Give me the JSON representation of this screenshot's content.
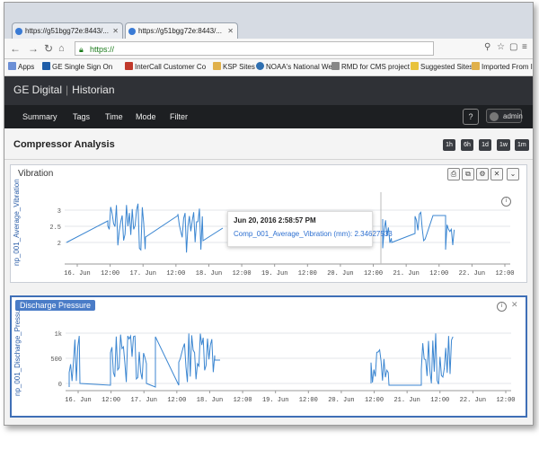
{
  "browser": {
    "tabs": [
      {
        "label": "https://g51bgg72e:8443/..."
      },
      {
        "label": "https://g51bgg72e:8443/..."
      }
    ],
    "url": "https://",
    "bookmarks": [
      {
        "label": "Apps",
        "color": "#6b8fd6"
      },
      {
        "label": "GE Single Sign On",
        "color": "#1f5ea8"
      },
      {
        "label": "InterCall Customer Co",
        "color": "#c0392b"
      },
      {
        "label": "KSP Sites",
        "color": "#e0b04a"
      },
      {
        "label": "NOAA's National Wea",
        "color": "#2f6fb0"
      },
      {
        "label": "RMD for CMS project",
        "color": "#888888"
      },
      {
        "label": "Suggested Sites",
        "color": "#e8c23a"
      },
      {
        "label": "Imported From IE",
        "color": "#e0b04a"
      }
    ]
  },
  "app": {
    "brand": "GE Digital",
    "product": "Historian",
    "menu": [
      "Summary",
      "Tags",
      "Time",
      "Mode",
      "Filter"
    ],
    "help": "?",
    "user": "admin"
  },
  "page": {
    "title": "Compressor Analysis",
    "ranges": [
      "1h",
      "6h",
      "1d",
      "1w",
      "1m"
    ]
  },
  "panels": {
    "vibration": {
      "title": "Vibration",
      "ylabel": "np_001_Average_Vibration",
      "yticks": [
        "3",
        "2.5",
        "2"
      ],
      "xticks": [
        "16. Jun",
        "12:00",
        "17. Jun",
        "12:00",
        "18. Jun",
        "12:00",
        "19. Jun",
        "12:00",
        "20. Jun",
        "12:00",
        "21. Jun",
        "12:00",
        "22. Jun",
        "12:00"
      ],
      "tooltip_time": "Jun 20, 2016 2:58:57 PM",
      "tooltip_value": "Comp_001_Average_Vibration (mm): 2.34627533"
    },
    "discharge": {
      "title": "Discharge Pressure",
      "ylabel": "np_001_Discharge_Pressu",
      "yticks": [
        "1k",
        "500",
        "0"
      ],
      "xticks": [
        "16. Jun",
        "12:00",
        "17. Jun",
        "12:00",
        "18. Jun",
        "12:00",
        "19. Jun",
        "12:00",
        "20. Jun",
        "12:00",
        "21. Jun",
        "12:00",
        "22. Jun",
        "12:00"
      ]
    }
  },
  "colors": {
    "accent": "#3f6fb6",
    "series": "#3b86d1",
    "header": "#2f3136",
    "menubar": "#1d1f22"
  }
}
